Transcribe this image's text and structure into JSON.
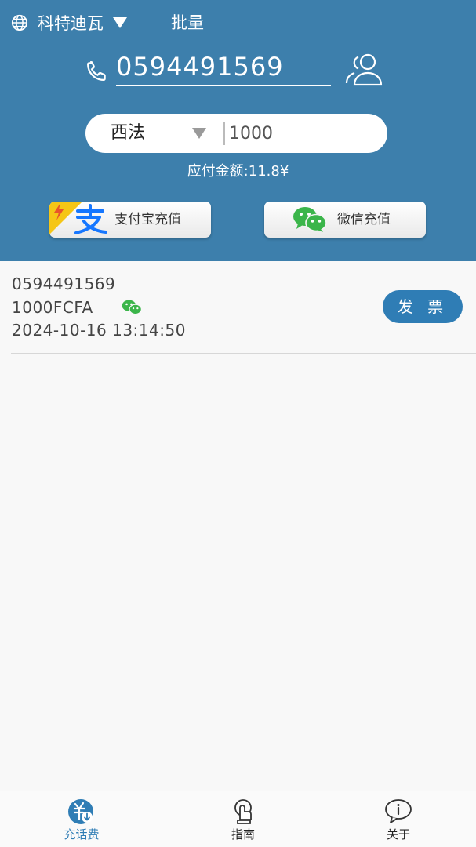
{
  "header": {
    "country": "科特迪瓦",
    "batch_label": "批量",
    "phone_value": "0594491569",
    "operator": "西法",
    "amount_value": "1000",
    "payable": "应付金额:11.8¥",
    "alipay_label": "支付宝充值",
    "wechat_label": "微信充值"
  },
  "records": [
    {
      "phone": "0594491569",
      "amount": "1000FCFA",
      "timestamp": "2024-10-16 13:14:50",
      "invoice_label": "发 票"
    }
  ],
  "tabbar": {
    "tabs": [
      {
        "label": "充话费",
        "icon": "recharge-icon",
        "active": true
      },
      {
        "label": "指南",
        "icon": "guide-icon",
        "active": false
      },
      {
        "label": "关于",
        "icon": "about-icon",
        "active": false
      }
    ]
  },
  "colors": {
    "header_bg": "#3d7fac",
    "accent": "#2f7db5",
    "wechat_green": "#3bb54a",
    "alipay_blue": "#1677ff",
    "alipay_corner": "#f5c616"
  }
}
